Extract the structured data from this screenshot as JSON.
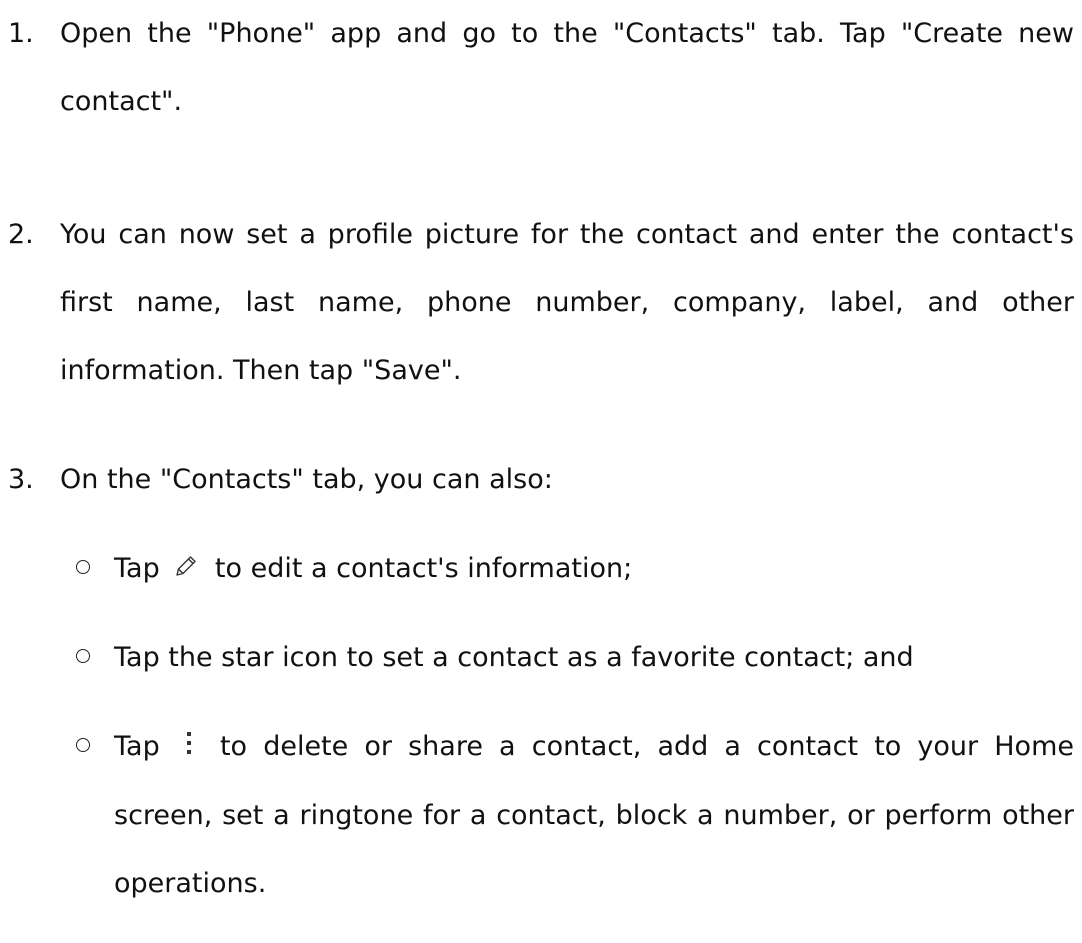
{
  "steps": [
    {
      "number": "1.",
      "text": "Open the \"Phone\" app and go to the \"Contacts\" tab. Tap \"Create new contact\"."
    },
    {
      "number": "2.",
      "text": "You can now set a profile picture for the contact and enter the contact's first name, last name, phone number, company, label, and other information. Then tap \"Save\"."
    },
    {
      "number": "3.",
      "text": "On the \"Contacts\" tab, you can also:"
    }
  ],
  "sub_items": [
    {
      "prefix": "Tap",
      "icon": "pencil-icon",
      "suffix": "to edit a contact's information;"
    },
    {
      "text": "Tap the star icon to set a contact as a favorite contact; and"
    },
    {
      "prefix": "Tap",
      "icon": "more-vertical-icon",
      "suffix": "to delete or share a contact, add a contact to your Home screen, set a ringtone for a contact, block a number, or perform other operations."
    }
  ]
}
